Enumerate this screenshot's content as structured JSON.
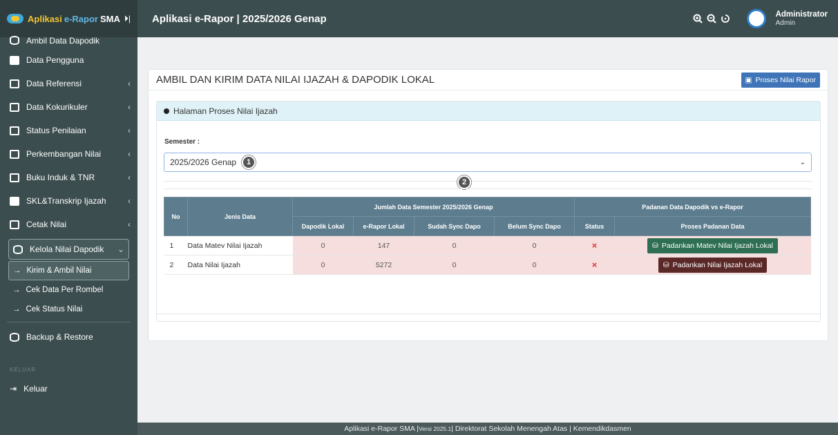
{
  "brand": {
    "part1": "Aplikasi",
    "part2": "e-Rapor",
    "part3": "SMA"
  },
  "topbar": {
    "title": "Aplikasi e-Rapor | 2025/2026 Genap",
    "user_name": "Administrator",
    "user_role": "Admin"
  },
  "sidebar": {
    "top_partial": "Ambil Data Dapodik",
    "items": [
      {
        "label": "Data Pengguna"
      },
      {
        "label": "Data Referensi"
      },
      {
        "label": "Data Kokurikuler"
      },
      {
        "label": "Status Penilaian"
      },
      {
        "label": "Perkembangan Nilai"
      },
      {
        "label": "Buku Induk & TNR"
      },
      {
        "label": "SKL&Transkrip Ijazah"
      },
      {
        "label": "Cetak Nilai"
      }
    ],
    "active": "Kelola Nilai Dapodik",
    "sub": [
      "Kirim & Ambil Nilai",
      "Cek Data Per Rombel",
      "Cek Status Nilai"
    ],
    "backup": "Backup & Restore",
    "section": "KELUAR",
    "logout": "Keluar"
  },
  "page": {
    "title": "AMBIL DAN KIRIM DATA NILAI IJAZAH & DAPODIK LOKAL",
    "proses_button": "Proses Nilai Rapor",
    "inner_title": "Halaman Proses Nilai Ijazah",
    "semester_label": "Semester :",
    "semester_value": "2025/2026 Genap",
    "badge1": "1",
    "badge2": "2"
  },
  "table": {
    "h_no": "No",
    "h_jenis": "Jenis Data",
    "h_group1": "Jumlah Data Semester 2025/2026 Genap",
    "h_group2": "Padanan Data Dapodik vs e-Rapor",
    "cols": [
      "Dapodik Lokal",
      "e-Rapor Lokal",
      "Sudah Sync Dapo",
      "Belum Sync Dapo",
      "Status",
      "Proses Padanan Data"
    ],
    "rows": [
      {
        "no": "1",
        "jenis": "Data Matev Nilai Ijazah",
        "dapodik": "0",
        "erapor": "147",
        "sudah": "0",
        "belum": "0",
        "status": "×",
        "aksi": "Padankan Matev Nilai Ijazah Lokal"
      },
      {
        "no": "2",
        "jenis": "Data Nilai Ijazah",
        "dapodik": "0",
        "erapor": "5272",
        "sudah": "0",
        "belum": "0",
        "status": "×",
        "aksi": "Padankan Nilai Ijazah Lokal"
      }
    ]
  },
  "footer": {
    "left": "Aplikasi e-Rapor SMA | ",
    "version": "Versi 2025.1",
    "right": " | Direktorat Sekolah Menengah Atas | Kemendikdasmen"
  },
  "colors": {
    "sidebar": "#3c4d4f",
    "table_head": "#5d7d8f",
    "btn_green": "#2e6e52",
    "btn_maroon": "#5b2828",
    "btn_blue": "#3f74b8"
  }
}
